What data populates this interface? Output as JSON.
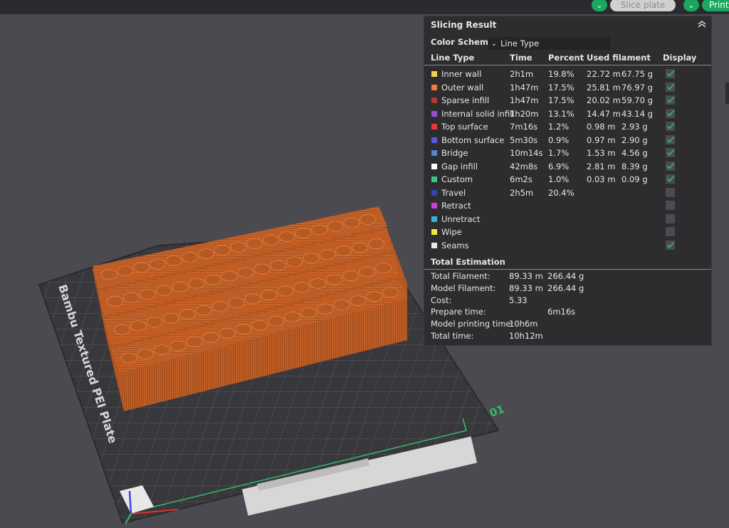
{
  "toolbar": {
    "slice_plate_label": "Slice plate",
    "print_label": "Print",
    "accent": "#18a860"
  },
  "scene": {
    "plate_label": "Bambu Textured PEI Plate",
    "plate_number": "01"
  },
  "panel": {
    "title": "Slicing Result",
    "color_scheme_label": "Color Scheme",
    "color_scheme_value": "Line Type",
    "columns": [
      "Line Type",
      "Time",
      "Percent",
      "Used filament",
      "Display"
    ],
    "rows": [
      {
        "type": "Inner wall",
        "color": "#f0d24a",
        "time": "2h1m",
        "percent": "19.8%",
        "length": "22.72 m",
        "weight": "67.75 g",
        "display": true
      },
      {
        "type": "Outer wall",
        "color": "#f07d3a",
        "time": "1h47m",
        "percent": "17.5%",
        "length": "25.81 m",
        "weight": "76.97 g",
        "display": true
      },
      {
        "type": "Sparse infill",
        "color": "#b03a2e",
        "time": "1h47m",
        "percent": "17.5%",
        "length": "20.02 m",
        "weight": "59.70 g",
        "display": true
      },
      {
        "type": "Internal solid infill",
        "color": "#9a4fd0",
        "time": "1h20m",
        "percent": "13.1%",
        "length": "14.47 m",
        "weight": "43.14 g",
        "display": true
      },
      {
        "type": "Top surface",
        "color": "#e23a3a",
        "time": "7m16s",
        "percent": "1.2%",
        "length": "0.98 m",
        "weight": "2.93 g",
        "display": true
      },
      {
        "type": "Bottom surface",
        "color": "#5a5ad8",
        "time": "5m30s",
        "percent": "0.9%",
        "length": "0.97 m",
        "weight": "2.90 g",
        "display": true
      },
      {
        "type": "Bridge",
        "color": "#4f87c8",
        "time": "10m14s",
        "percent": "1.7%",
        "length": "1.53 m",
        "weight": "4.56 g",
        "display": true
      },
      {
        "type": "Gap infill",
        "color": "#ffffff",
        "time": "42m8s",
        "percent": "6.9%",
        "length": "2.81 m",
        "weight": "8.39 g",
        "display": true
      },
      {
        "type": "Custom",
        "color": "#36c58a",
        "time": "6m2s",
        "percent": "1.0%",
        "length": "0.03 m",
        "weight": "0.09 g",
        "display": true
      },
      {
        "type": "Travel",
        "color": "#3444a8",
        "time": "2h5m",
        "percent": "20.4%",
        "length": "",
        "weight": "",
        "display": false
      },
      {
        "type": "Retract",
        "color": "#d43ad8",
        "time": "",
        "percent": "",
        "length": "",
        "weight": "",
        "display": false
      },
      {
        "type": "Unretract",
        "color": "#3ab0d8",
        "time": "",
        "percent": "",
        "length": "",
        "weight": "",
        "display": false
      },
      {
        "type": "Wipe",
        "color": "#f0e83a",
        "time": "",
        "percent": "",
        "length": "",
        "weight": "",
        "display": false
      },
      {
        "type": "Seams",
        "color": "#e8e8e8",
        "time": "",
        "percent": "",
        "length": "",
        "weight": "",
        "display": true
      }
    ],
    "total_title": "Total Estimation",
    "totals": [
      {
        "label": "Total Filament:",
        "value": "89.33 m",
        "value2": "266.44 g"
      },
      {
        "label": "Model Filament:",
        "value": "89.33 m",
        "value2": "266.44 g"
      },
      {
        "label": "Cost:",
        "value": "5.33",
        "value2": ""
      },
      {
        "label": "Prepare time:",
        "value": "",
        "value2": "6m16s"
      },
      {
        "label": "Model printing time:",
        "value": "10h6m",
        "value2": ""
      },
      {
        "label": "Total time:",
        "value": "10h12m",
        "value2": ""
      }
    ]
  }
}
